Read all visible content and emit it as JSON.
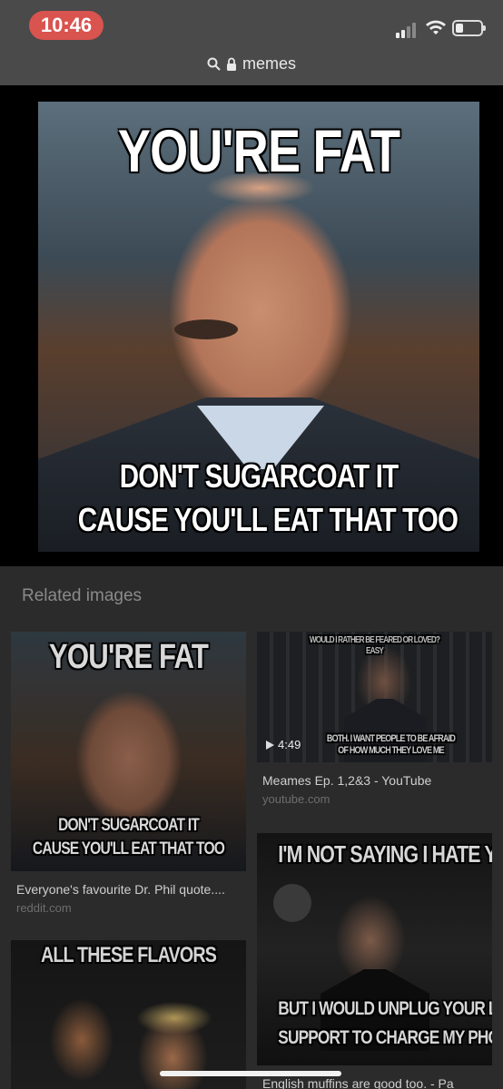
{
  "status_bar": {
    "time": "10:46",
    "battery_level": 0.3,
    "colors": {
      "time_pill": "#d9534f"
    }
  },
  "url_bar": {
    "text": "memes"
  },
  "icons": [
    "search-icon",
    "lock-icon",
    "signal-icon",
    "wifi-icon",
    "battery-icon",
    "play-icon"
  ],
  "hero_image": {
    "caption_top": "YOU'RE FAT",
    "caption_bottom_line1": "DON'T SUGARCOAT IT",
    "caption_bottom_line2": "CAUSE YOU'LL EAT THAT TOO"
  },
  "related": {
    "heading": "Related images",
    "items": [
      {
        "caption_top": "YOU'RE FAT",
        "caption_bottom_line1": "DON'T SUGARCOAT IT",
        "caption_bottom_line2": "CAUSE YOU'LL EAT THAT TOO",
        "title": "Everyone's favourite Dr. Phil quote....",
        "source": "reddit.com"
      },
      {
        "caption_top_line1": "WOULD I RATHER BE FEARED OR LOVED?",
        "caption_top_line2": "EASY",
        "caption_bottom_line1": "BOTH. I WANT PEOPLE TO BE AFRAID",
        "caption_bottom_line2": "OF HOW MUCH THEY LOVE ME",
        "duration": "4:49",
        "title": "Meames Ep. 1,2&3 - YouTube",
        "source": "youtube.com"
      },
      {
        "caption_top": "I'M NOT SAYING I HATE YOU",
        "caption_bottom_line1": "BUT I WOULD UNPLUG YOUR LIFE",
        "caption_bottom_line2": "SUPPORT TO CHARGE MY PHONE",
        "title": "English muffins are good too. - Pa"
      },
      {
        "caption_top": "ALL THESE FLAVORS"
      }
    ]
  }
}
